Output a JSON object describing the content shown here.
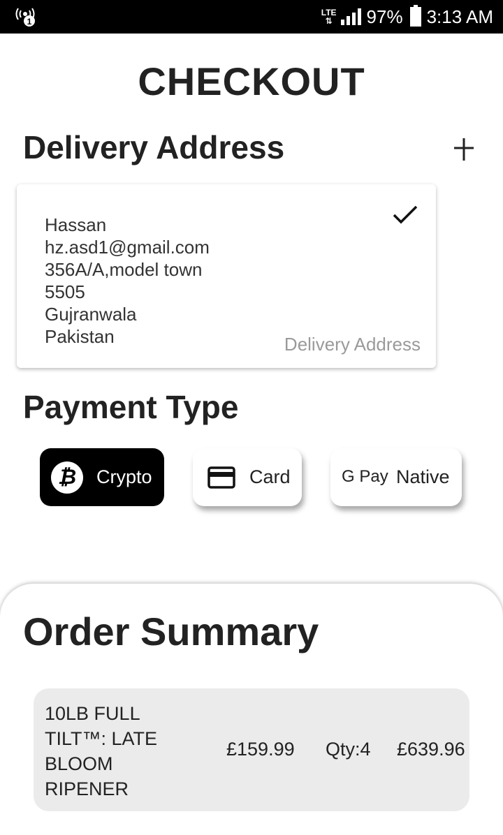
{
  "status_bar": {
    "network": "LTE",
    "battery": "97%",
    "time": "3:13 AM",
    "notification_badge": "1"
  },
  "page": {
    "title": "CHECKOUT"
  },
  "delivery": {
    "heading": "Delivery Address",
    "add_icon": "plus-icon",
    "card": {
      "name": "Hassan",
      "email": "hz.asd1@gmail.com",
      "street": "356A/A,model town",
      "postal_code": "5505",
      "city": "Gujranwala",
      "country": "Pakistan",
      "tag": "Delivery Address",
      "selected": true
    }
  },
  "payment": {
    "heading": "Payment Type",
    "options": [
      {
        "label": "Crypto",
        "icon": "bitcoin-icon",
        "icon_glyph": "₿",
        "selected": true
      },
      {
        "label": "Card",
        "icon": "credit-card-icon",
        "selected": false
      },
      {
        "label": "Native",
        "icon": "google-pay-icon",
        "icon_text": "G Pay",
        "selected": false
      }
    ]
  },
  "summary": {
    "heading": "Order Summary",
    "items": [
      {
        "name": "10LB FULL TILT™: LATE BLOOM RIPENER",
        "price": "£159.99",
        "qty": "Qty:4",
        "total": "£639.96"
      }
    ]
  },
  "colors": {
    "selected_bg": "#000000",
    "card_bg": "#ffffff",
    "order_row_bg": "#ebebeb",
    "muted_text": "#9a9a9a"
  }
}
